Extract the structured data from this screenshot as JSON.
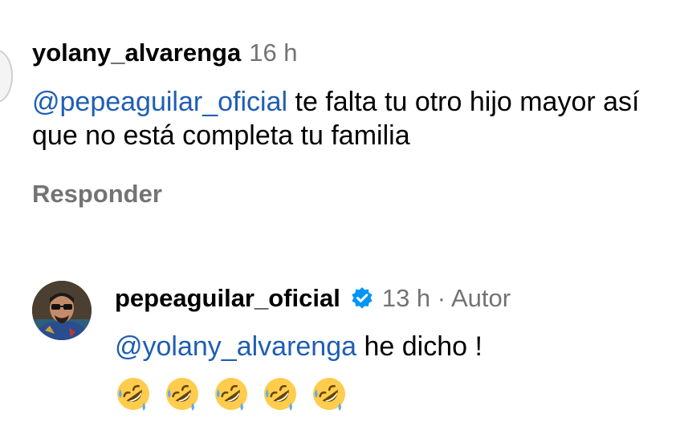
{
  "comment": {
    "username": "yolany_alvarenga",
    "time": "16 h",
    "mention": "@pepeaguilar_oficial",
    "text": "  te falta tu otro hijo mayor así que no está completa tu familia",
    "reply_label": "Responder"
  },
  "reply": {
    "username": "pepeaguilar_oficial",
    "verified_icon": "verified-badge-icon",
    "meta": "13 h · Autor",
    "mention": "@yolany_alvarenga",
    "text": " he dicho !",
    "emojis": [
      "rolling-on-floor-laughing-icon",
      "rolling-on-floor-laughing-icon",
      "rolling-on-floor-laughing-icon",
      "rolling-on-floor-laughing-icon",
      "rolling-on-floor-laughing-icon"
    ]
  },
  "colors": {
    "mention": "#1f5eb3",
    "meta": "#737373",
    "verified": "#0095f6",
    "emoji": "#ffcc4d"
  }
}
